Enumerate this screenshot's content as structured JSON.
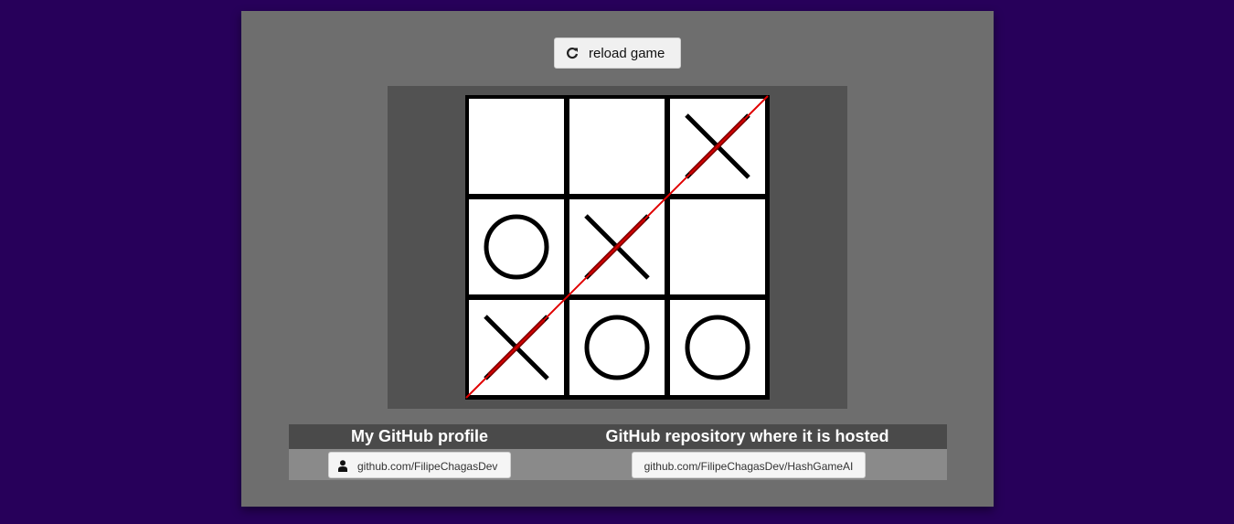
{
  "toolbar": {
    "reload_label": "reload game",
    "reload_icon": "refresh-icon"
  },
  "game": {
    "board": [
      [
        "",
        "",
        "X"
      ],
      [
        "O",
        "X",
        ""
      ],
      [
        "X",
        "O",
        "O"
      ]
    ],
    "winning_line": "anti-diagonal",
    "colors": {
      "background": "#27005a",
      "panel": "#6e6e6e",
      "board_area": "#525252",
      "cell": "#ffffff",
      "grid": "#000000",
      "win_line": "#e00000"
    }
  },
  "links": {
    "profile_title": "My GitHub profile",
    "profile_link": "github.com/FilipeChagasDev",
    "profile_icon": "user-icon",
    "repo_title": "GitHub repository where it is hosted",
    "repo_link": "github.com/FilipeChagasDev/HashGameAI"
  }
}
